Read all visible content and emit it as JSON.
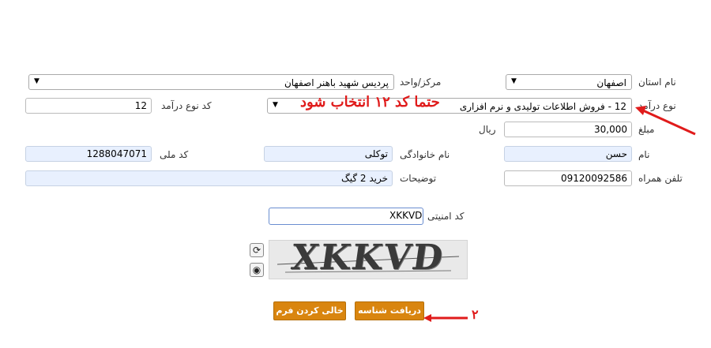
{
  "form": {
    "province_label": "نام استان",
    "province_value": "اصفهان",
    "center_label": "مرکز/واحد",
    "center_value": "پردیس شهید باهنر اصفهان",
    "income_type_label": "نوع درآمد",
    "income_type_value": "12 - فروش اطلاعات تولیدی و نرم افزاری",
    "income_code_label": "کد نوع درآمد",
    "income_code_value": "12",
    "amount_label": "مبلغ",
    "amount_value": "30,000",
    "currency_label": "ریال",
    "first_name_label": "نام",
    "first_name_value": "حسن",
    "last_name_label": "نام خانوادگی",
    "last_name_value": "توکلی",
    "national_id_label": "کد ملی",
    "national_id_value": "1288047071",
    "mobile_label": "تلفن همراه",
    "mobile_value": "09120092586",
    "description_label": "توضیحات",
    "description_value": "خرید 2 گیگ",
    "security_code_label": "کد امنیتی",
    "security_code_value": "XKKVD",
    "captcha_text": "XKKVD"
  },
  "annotations": {
    "note_income_type": "حتما کد ۱۲ انتخاب شود",
    "step_number": "۲"
  },
  "buttons": {
    "get_id_label": "دریافت شناسه",
    "clear_form_label": "خالی کردن فرم"
  },
  "icons": {
    "refresh": "refresh-icon",
    "audio": "audio-icon",
    "dropdown": "chevron-down-icon"
  },
  "colors": {
    "button_bg": "#d9850f",
    "readonly_bg": "#e8f0fe",
    "annotation_red": "#e01b1b"
  }
}
